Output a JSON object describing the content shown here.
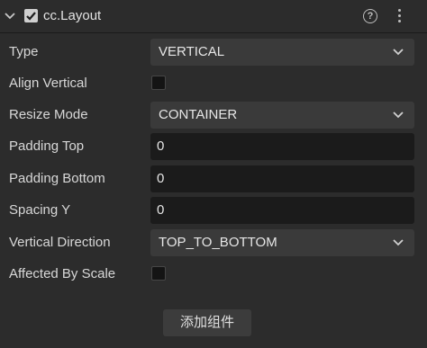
{
  "header": {
    "title": "cc.Layout",
    "enabled": true,
    "help_glyph": "?",
    "icons": [
      "chevron-down-icon",
      "check-icon",
      "help-icon",
      "more-vertical-icon"
    ]
  },
  "properties": {
    "type": {
      "label": "Type",
      "value": "VERTICAL"
    },
    "align_vertical": {
      "label": "Align Vertical",
      "checked": false
    },
    "resize_mode": {
      "label": "Resize Mode",
      "value": "CONTAINER"
    },
    "padding_top": {
      "label": "Padding Top",
      "value": "0"
    },
    "padding_bottom": {
      "label": "Padding Bottom",
      "value": "0"
    },
    "spacing_y": {
      "label": "Spacing Y",
      "value": "0"
    },
    "vertical_direction": {
      "label": "Vertical Direction",
      "value": "TOP_TO_BOTTOM"
    },
    "affected_by_scale": {
      "label": "Affected By Scale",
      "checked": false
    }
  },
  "add_component_label": "添加组件",
  "colors": {
    "background": "#2c2c2c",
    "select_bg": "#3a3a3a",
    "input_bg": "#1b1b1b",
    "text": "#d8d8d8"
  }
}
